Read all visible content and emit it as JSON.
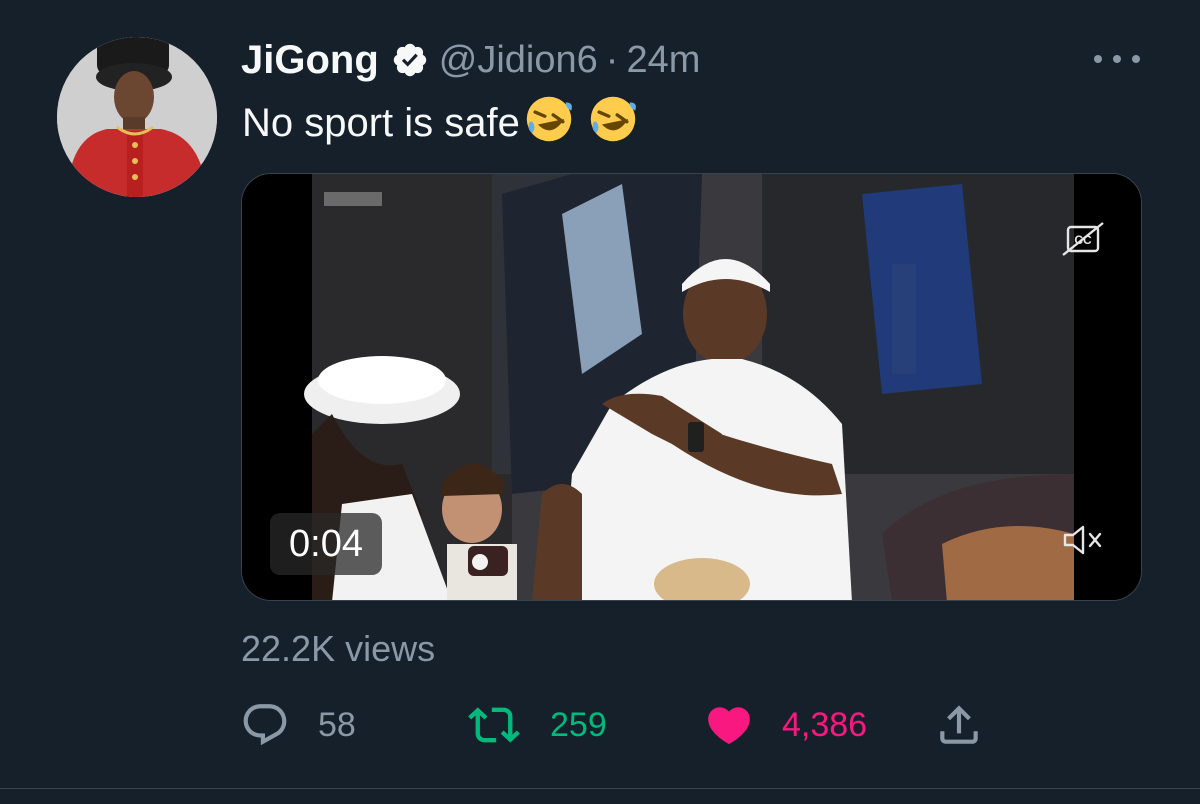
{
  "tweet": {
    "display_name": "JiGong",
    "handle": "@Jidion6",
    "separator": "·",
    "time": "24m",
    "text": "No sport is safe",
    "emojis": [
      "rolling-on-floor-laughing",
      "rolling-on-floor-laughing"
    ]
  },
  "video": {
    "duration": "0:04"
  },
  "stats": {
    "views": "22.2K views",
    "replies": "58",
    "retweets": "259",
    "likes": "4,386"
  },
  "colors": {
    "background": "#15202b",
    "text": "#f7f9f9",
    "secondary": "#8b98a5",
    "retweet": "#00ba7c",
    "like": "#f91880"
  }
}
